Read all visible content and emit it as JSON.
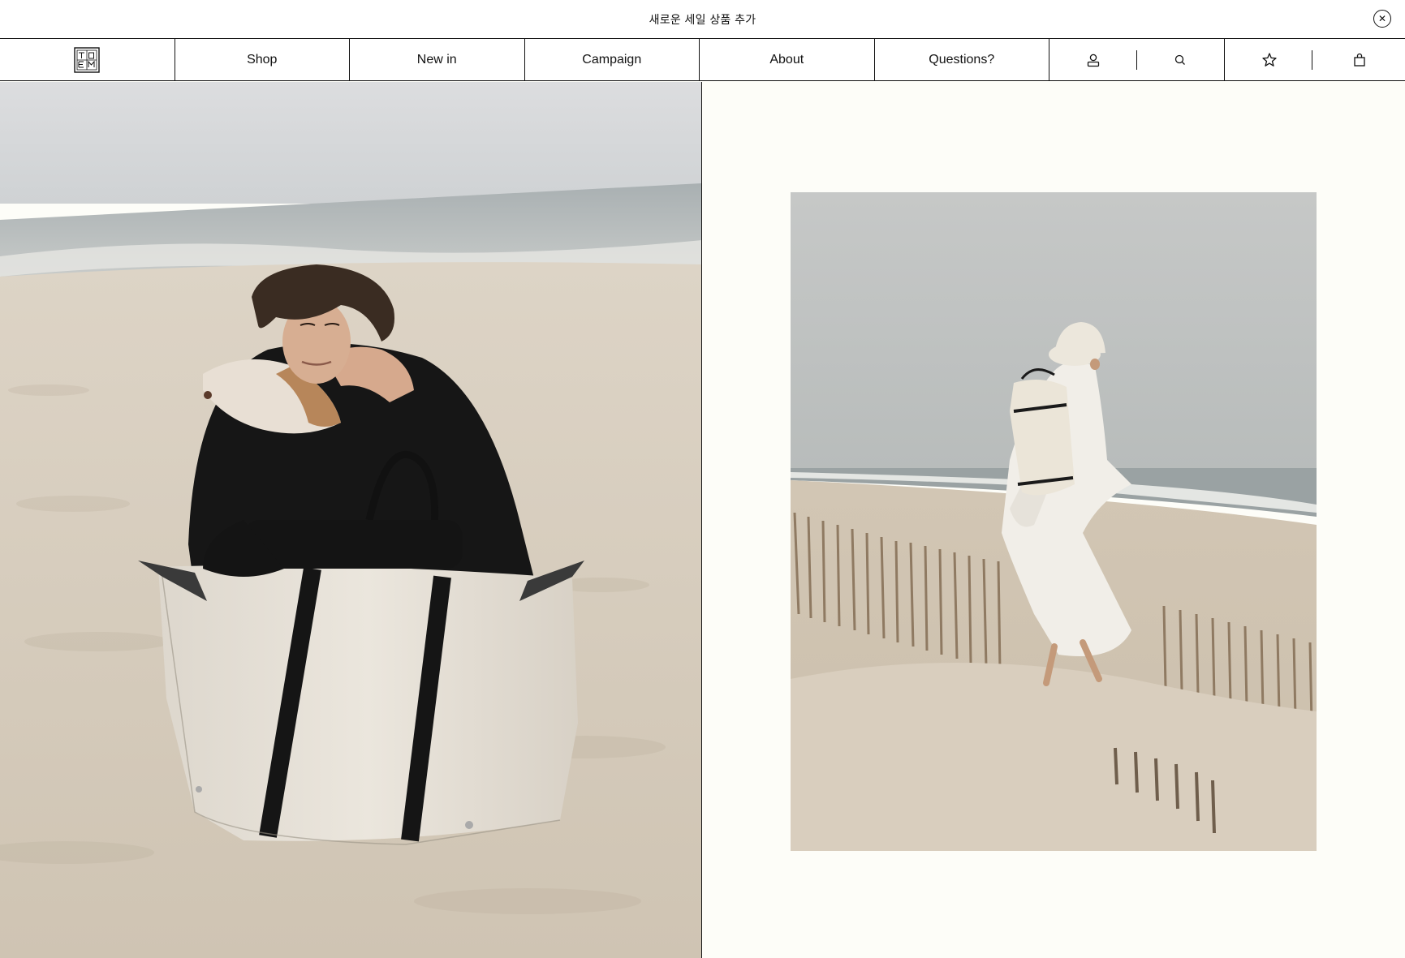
{
  "announcement": {
    "text": "새로운 세일 상품 추가",
    "close_icon": "close-circle-icon"
  },
  "nav": {
    "logo_icon": "toteme-monogram-logo",
    "items": [
      {
        "label": "Shop"
      },
      {
        "label": "New in"
      },
      {
        "label": "Campaign"
      },
      {
        "label": "About"
      },
      {
        "label": "Questions?"
      }
    ],
    "icons": [
      "account-icon",
      "search-icon",
      "wishlist-star-icon",
      "shopping-bag-icon"
    ]
  },
  "hero": {
    "left_image": "Woman in black knit sweater hugging a dog behind a large canvas tote bag on the beach",
    "right_image": "Woman in white dress and bucket hat carrying a canvas backpack walking over sand dunes"
  },
  "colors": {
    "background": "#fdfdf8",
    "border": "#111111",
    "header_bg": "#ffffff"
  }
}
